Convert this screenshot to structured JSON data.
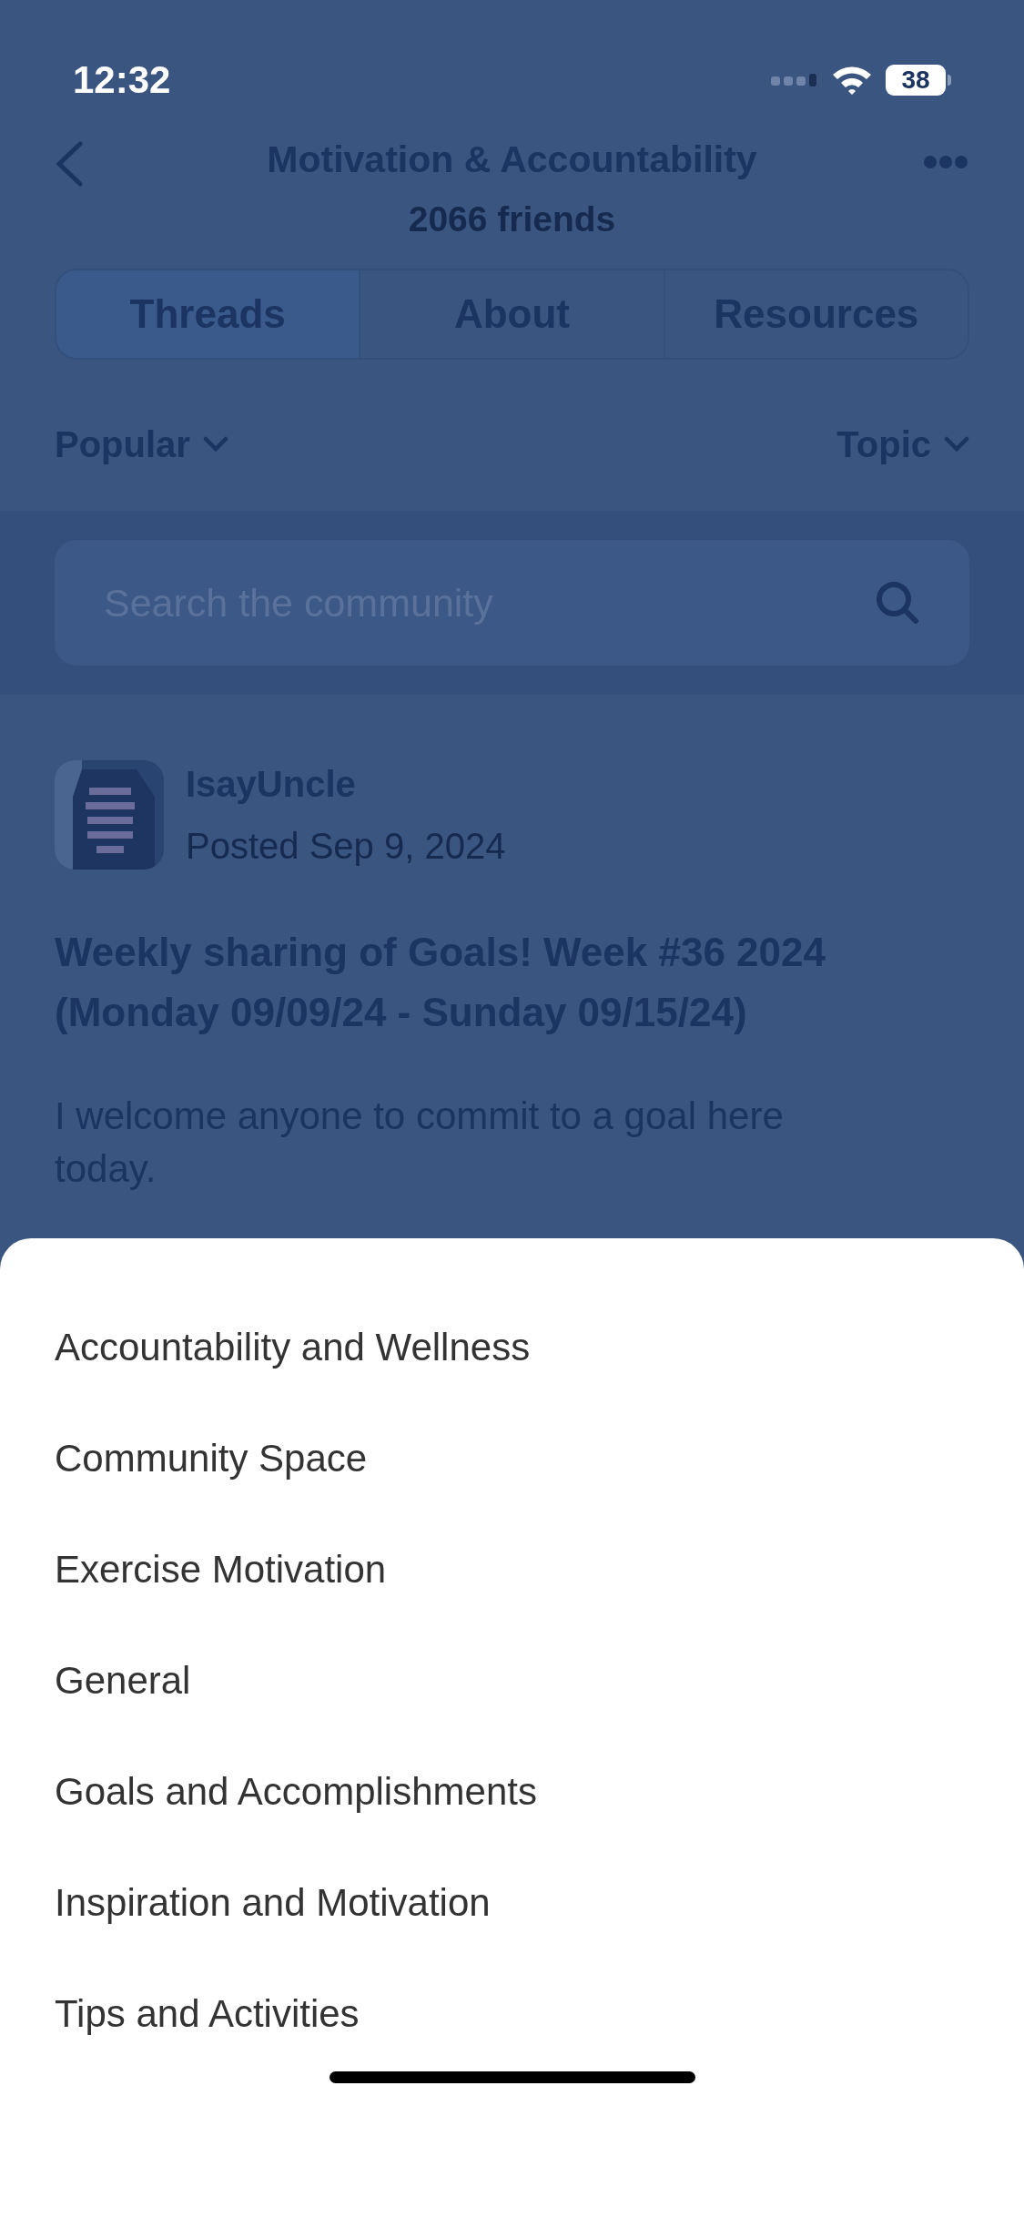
{
  "status_bar": {
    "time": "12:32",
    "battery": "38"
  },
  "header": {
    "title": "Motivation & Accountability",
    "subtitle": "2066 friends"
  },
  "tabs": [
    {
      "label": "Threads",
      "selected": true
    },
    {
      "label": "About",
      "selected": false
    },
    {
      "label": "Resources",
      "selected": false
    }
  ],
  "filters": [
    {
      "label": "Popular"
    },
    {
      "label": "Topic"
    }
  ],
  "search": {
    "placeholder": "Search the community"
  },
  "post": {
    "avatar": {
      "kind": "picture"
    },
    "author": "IsayUncle",
    "date": "Posted Sep 9, 2024",
    "title": "Weekly sharing of Goals! Week #36 2024 (Monday 09/09/24 - Sunday 09/15/24)",
    "body": [
      "I welcome anyone to commit to a goal here today."
    ]
  },
  "topic_sheet": {
    "items": [
      {
        "label": "Accountability and Wellness"
      },
      {
        "label": "Community Space"
      },
      {
        "label": "Exercise Motivation"
      },
      {
        "label": "General"
      },
      {
        "label": "Goals and Accomplishments"
      },
      {
        "label": "Inspiration and Motivation"
      },
      {
        "label": "Tips and Activities"
      }
    ]
  }
}
